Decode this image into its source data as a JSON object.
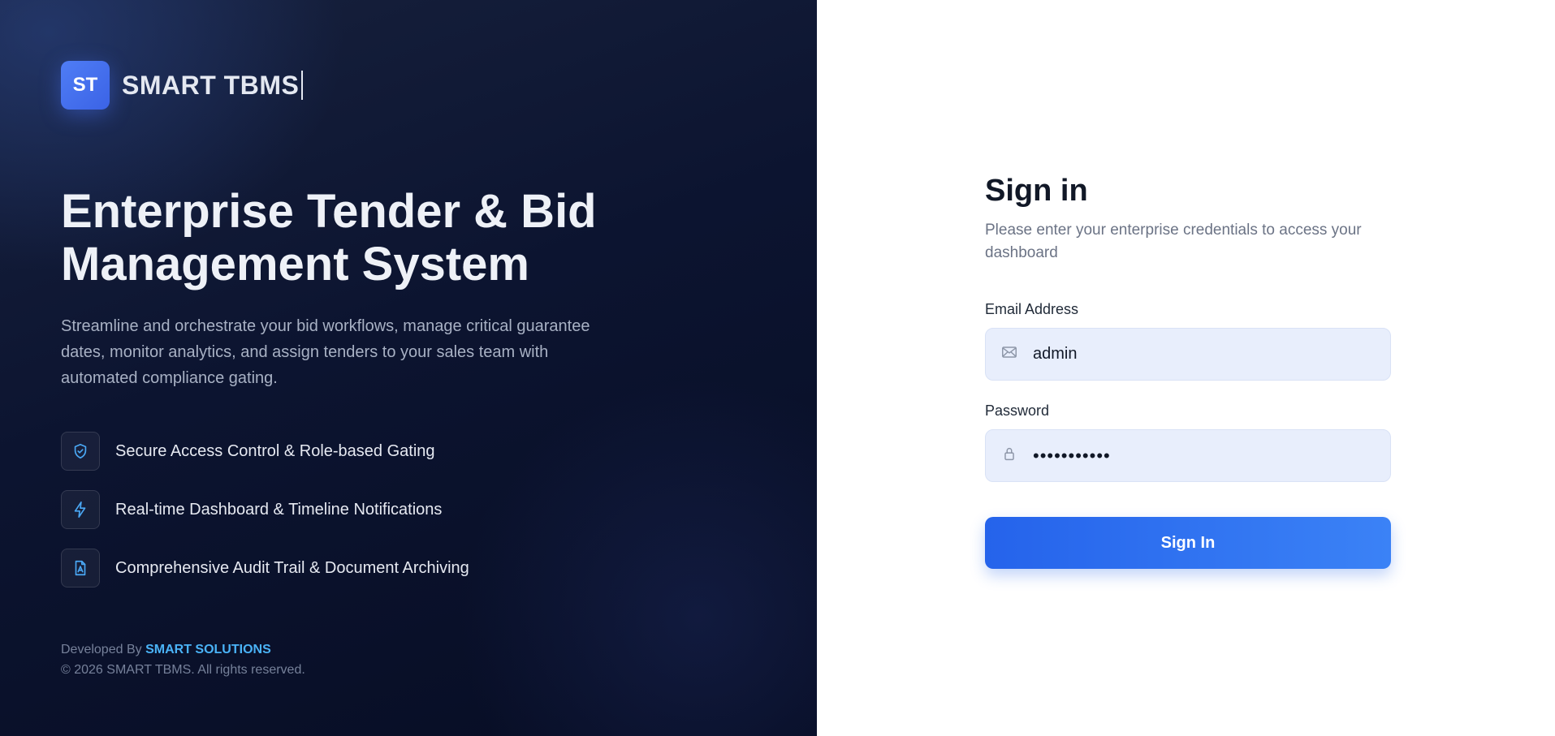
{
  "brand": {
    "logo_text": "ST",
    "name": "SMART TBMS"
  },
  "hero": {
    "headline": "Enterprise Tender & Bid Management System",
    "subtext": "Streamline and orchestrate your bid workflows, manage critical guarantee dates, monitor analytics, and assign tenders to your sales team with automated compliance gating.",
    "features": [
      {
        "icon": "shield-check-icon",
        "label": "Secure Access Control & Role-based Gating"
      },
      {
        "icon": "lightning-icon",
        "label": "Real-time Dashboard & Timeline Notifications"
      },
      {
        "icon": "document-archive-icon",
        "label": "Comprehensive Audit Trail & Document Archiving"
      }
    ],
    "footer": {
      "developed_by": "Developed By",
      "company": "SMART SOLUTIONS",
      "copyright": "© 2026 SMART TBMS. All rights reserved."
    }
  },
  "auth": {
    "title": "Sign in",
    "subtitle": "Please enter your enterprise credentials to access your dashboard",
    "email": {
      "label": "Email Address",
      "icon": "mail-icon",
      "value": "admin"
    },
    "password": {
      "label": "Password",
      "icon": "lock-icon",
      "value": "admin123456"
    },
    "submit_label": "Sign In"
  },
  "colors": {
    "hero_bg": "#0c1430",
    "accent": "#3b82f6",
    "accent_dark": "#2563eb",
    "link_accent": "#4ab3f7",
    "input_bg": "#e8eefc"
  }
}
